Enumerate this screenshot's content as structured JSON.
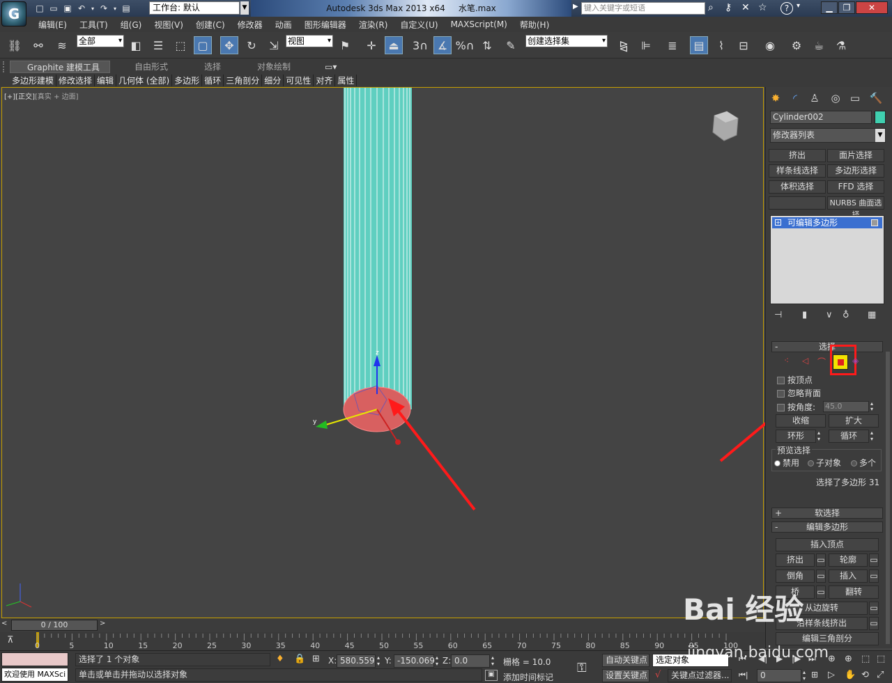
{
  "titlebar": {
    "logo_letter": "G",
    "workspace_label": "工作台: 默认",
    "app_title": "Autodesk 3ds Max  2013 x64",
    "file_name": "水笔.max",
    "search_placeholder": "键入关键字或短语",
    "help_label": "?"
  },
  "menu": [
    "编辑(E)",
    "工具(T)",
    "组(G)",
    "视图(V)",
    "创建(C)",
    "修改器",
    "动画",
    "图形编辑器",
    "渲染(R)",
    "自定义(U)",
    "MAXScript(M)",
    "帮助(H)"
  ],
  "toolbar": {
    "selection_filter": "全部",
    "ref_coord": "视图",
    "named_selection": "创建选择集",
    "snap_label": "3",
    "percent_label": "%"
  },
  "ribbon": {
    "tabs": [
      "Graphite 建模工具",
      "自由形式",
      "选择",
      "对象绘制"
    ],
    "subtabs": [
      "多边形建模",
      "修改选择",
      "编辑",
      "几何体 (全部)",
      "多边形",
      "循环",
      "三角剖分",
      "细分",
      "可见性",
      "对齐",
      "属性"
    ]
  },
  "viewport": {
    "label_bracket": "[+]",
    "label_view": "[正交]",
    "label_shading": "[真实 + 边面]",
    "axis_z": "z",
    "axis_y": "y"
  },
  "command_panel": {
    "object_name": "Cylinder002",
    "object_color": "#40d0b0",
    "modifier_list": "修改器列表",
    "modifier_buttons": [
      "挤出",
      "面片选择",
      "样条线选择",
      "多边形选择",
      "体积选择",
      "FFD 选择",
      "",
      "NURBS 曲面选择"
    ],
    "stack_item": "可编辑多边形",
    "selection_rollout": "选择",
    "by_vertex": "按顶点",
    "ignore_backfacing": "忽略背面",
    "by_angle": "按角度:",
    "angle_value": "45.0",
    "shrink": "收缩",
    "grow": "扩大",
    "ring": "环形",
    "loop": "循环",
    "preview_selection": "预览选择",
    "preview_options": [
      "禁用",
      "子对象",
      "多个"
    ],
    "selection_status": "选择了多边形 31",
    "soft_selection": "软选择",
    "edit_polygons": "编辑多边形",
    "insert_vertex": "插入顶点",
    "edit_buttons": [
      "挤出",
      "轮廓",
      "倒角",
      "插入",
      "桥",
      "翻转"
    ],
    "hinge_from_edge": "从边旋转",
    "extrude_along_spline": "沿样条线挤出",
    "edit_triangulation": "编辑三角剖分"
  },
  "timeline": {
    "frame_display": "0 / 100",
    "ticks": [
      "0",
      "5",
      "10",
      "15",
      "20",
      "25",
      "30",
      "35",
      "40",
      "45",
      "50",
      "55",
      "60",
      "65",
      "70",
      "75",
      "80",
      "85",
      "90",
      "95",
      "100"
    ]
  },
  "status": {
    "welcome": "欢迎使用 MAXSci",
    "selected": "选择了 1 个对象",
    "prompt": "单击或单击并拖动以选择对象",
    "x_label": "X:",
    "x_value": "580.559",
    "y_label": "Y:",
    "y_value": "-150.069",
    "z_label": "Z:",
    "z_value": "0.0",
    "grid": "栅格 = 10.0",
    "auto_key": "自动关键点",
    "set_key": "设置关键点",
    "key_mode": "选定对象",
    "key_filters": "关键点过滤器...",
    "add_time_tag": "添加时间标记",
    "frame_value": "0"
  },
  "watermark": {
    "brand": "Bai 经验",
    "url": "jingyan.baidu.com"
  }
}
